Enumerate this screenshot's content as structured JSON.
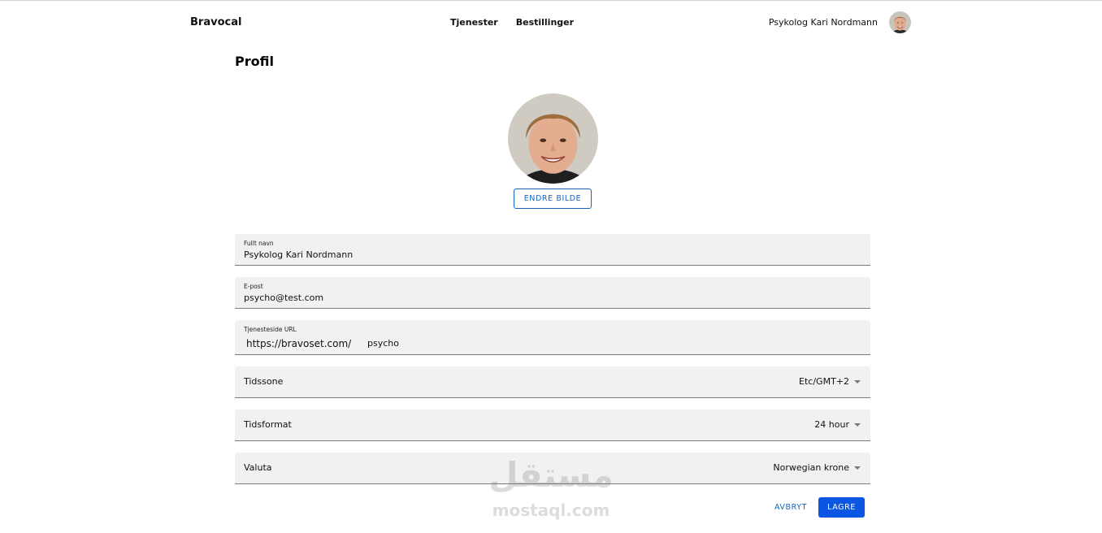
{
  "header": {
    "brand": "Bravocal",
    "nav": [
      "Tjenester",
      "Bestillinger"
    ],
    "user_name": "Psykolog Kari Nordmann"
  },
  "page": {
    "title": "Profil",
    "change_photo_label": "ENDRE BILDE"
  },
  "form": {
    "full_name": {
      "label": "Fullt navn",
      "value": "Psykolog Kari Nordmann"
    },
    "email": {
      "label": "E-post",
      "value": "psycho@test.com"
    },
    "service_url": {
      "label": "Tjenesteside URL",
      "prefix": "https://bravoset.com/",
      "value": "psycho"
    },
    "timezone": {
      "label": "Tidssone",
      "value": "Etc/GMT+2"
    },
    "time_format": {
      "label": "Tidsformat",
      "value": "24 hour"
    },
    "currency": {
      "label": "Valuta",
      "value": "Norwegian krone"
    }
  },
  "actions": {
    "cancel": "AVBRYT",
    "save": "LAGRE"
  },
  "watermark": {
    "arabic": "مستقل",
    "latin": "mostaql.com"
  },
  "colors": {
    "primary": "#0b57e3",
    "link": "#1565c0",
    "field_bg": "#f1f1f1"
  }
}
